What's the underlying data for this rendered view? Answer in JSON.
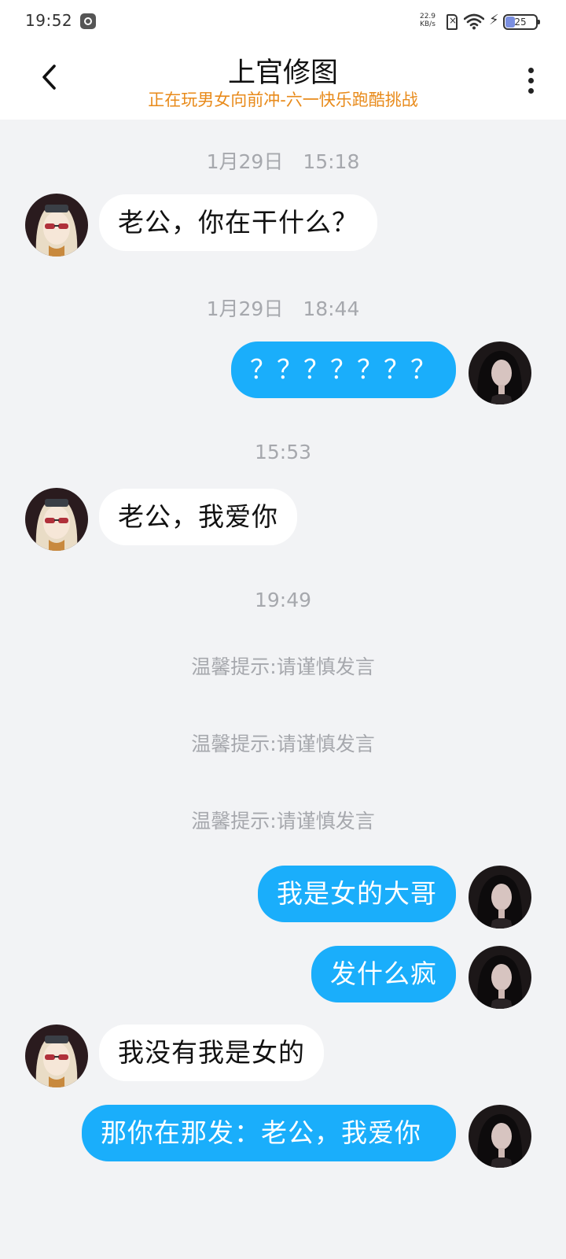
{
  "status_bar": {
    "time": "19:52",
    "net_speed_value": "22.9",
    "net_speed_unit": "KB/s",
    "battery": "25",
    "icons": [
      "app-notification-icon",
      "sim-no-service-icon",
      "wifi-icon",
      "charging-bolt-icon",
      "battery-icon"
    ]
  },
  "header": {
    "title": "上官修图",
    "subtitle": "正在玩男女向前冲-六一快乐跑酷挑战",
    "back_icon": "chevron-left-icon",
    "more_icon": "more-vertical-icon"
  },
  "colors": {
    "outgoing_bubble": "#1aaefb",
    "incoming_bubble": "#ffffff",
    "subtitle": "#e88a1a",
    "timestamp": "#a6a8ad",
    "background": "#f2f3f5"
  },
  "chat": {
    "timestamps": [
      "1月29日　15:18",
      "1月29日　18:44",
      "15:53",
      "19:49"
    ],
    "notices": [
      "温馨提示:请谨慎发言",
      "温馨提示:请谨慎发言",
      "温馨提示:请谨慎发言"
    ],
    "messages": [
      {
        "sender": "contact",
        "text": "老公，你在干什么？"
      },
      {
        "sender": "me",
        "text": "？？？？？？？"
      },
      {
        "sender": "contact",
        "text": "老公，我爱你"
      },
      {
        "sender": "me",
        "text": "我是女的大哥"
      },
      {
        "sender": "me",
        "text": "发什么疯"
      },
      {
        "sender": "contact",
        "text": "我没有我是女的"
      },
      {
        "sender": "me",
        "text": "那你在那发：老公，我爱你"
      }
    ]
  }
}
